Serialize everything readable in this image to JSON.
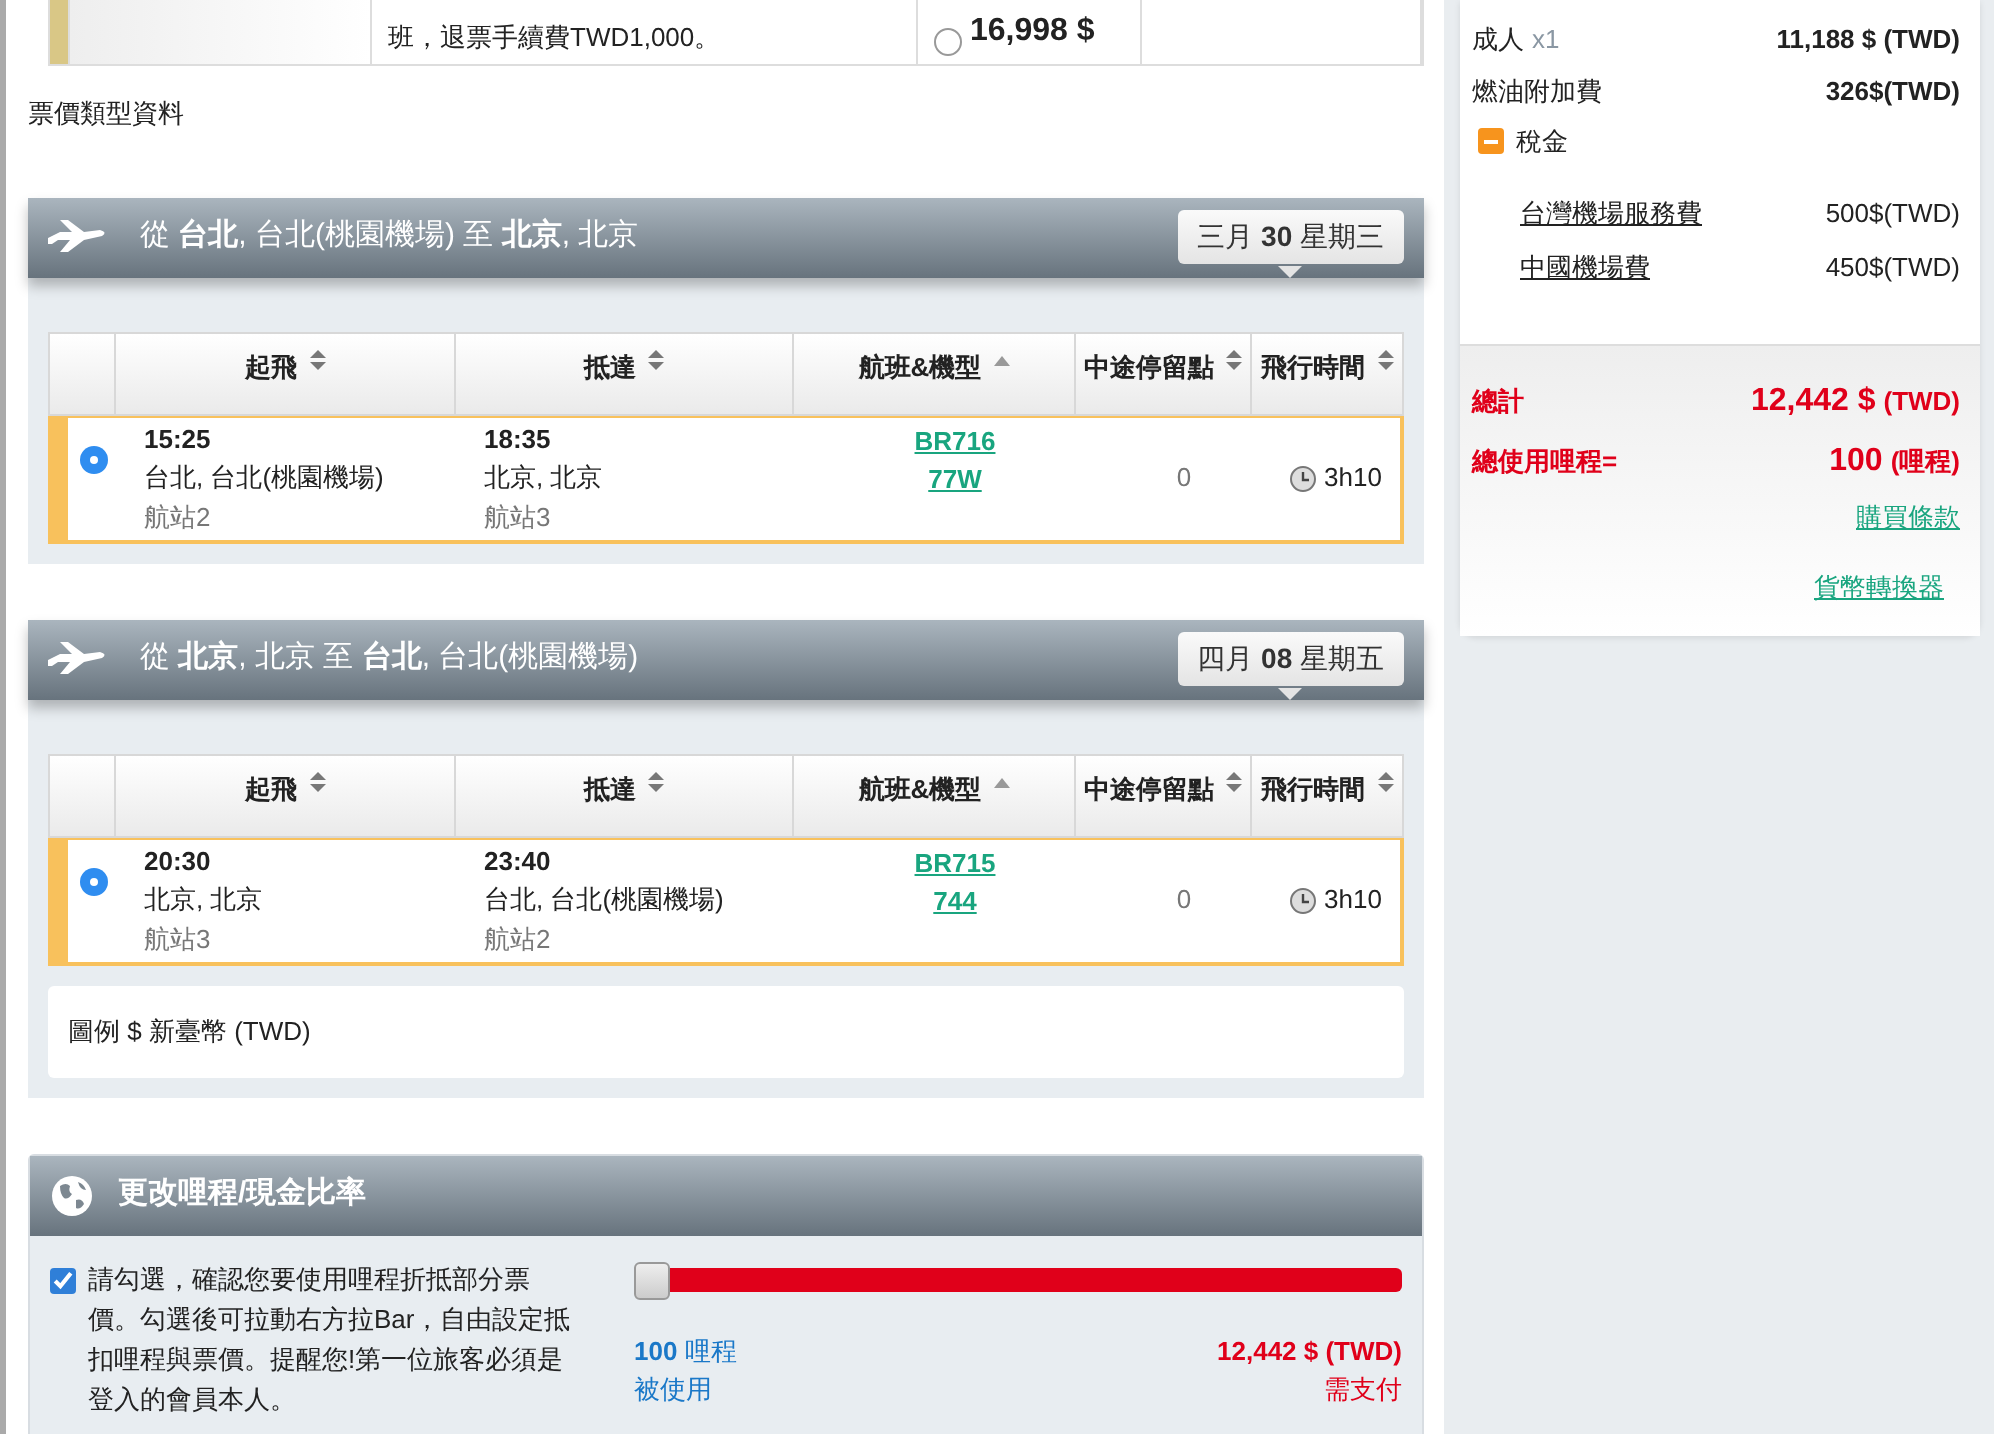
{
  "fare_row": {
    "note": "班，退票手續費TWD1,000。",
    "price": "16,998 $",
    "selected": false
  },
  "fare_type_link": "票價類型資料",
  "segments": [
    {
      "title": "從 **台北**, 台北(桃園機場) 至 **北京**, 北京",
      "date": "三月 **30** 星期三",
      "columns": [
        {
          "label": "起飛",
          "sorted": false
        },
        {
          "label": "抵達",
          "sorted": false
        },
        {
          "label": "航班&機型",
          "sorted": true
        },
        {
          "label": "中途停留點",
          "sorted": false
        },
        {
          "label": "飛行時間",
          "sorted": false
        }
      ],
      "flights": [
        {
          "selected": true,
          "depart_time": "15:25",
          "depart_city": "台北, 台北(桃園機場)",
          "depart_terminal": "航站2",
          "arrive_time": "18:35",
          "arrive_city": "北京, 北京",
          "arrive_terminal": "航站3",
          "flight_no": "BR716",
          "aircraft": "77W",
          "stops": "0",
          "duration": "3h10"
        }
      ]
    },
    {
      "title": "從 **北京**, 北京 至 **台北**, 台北(桃園機場)",
      "date": "四月 **08** 星期五",
      "columns": [
        {
          "label": "起飛",
          "sorted": false
        },
        {
          "label": "抵達",
          "sorted": false
        },
        {
          "label": "航班&機型",
          "sorted": true
        },
        {
          "label": "中途停留點",
          "sorted": false
        },
        {
          "label": "飛行時間",
          "sorted": false
        }
      ],
      "flights": [
        {
          "selected": true,
          "depart_time": "20:30",
          "depart_city": "北京, 北京",
          "depart_terminal": "航站3",
          "arrive_time": "23:40",
          "arrive_city": "台北, 台北(桃園機場)",
          "arrive_terminal": "航站2",
          "flight_no": "BR715",
          "aircraft": "744",
          "stops": "0",
          "duration": "3h10"
        }
      ]
    }
  ],
  "legend": "圖例 $ 新臺幣 (TWD)",
  "miles_panel": {
    "title": "更改哩程/現金比率",
    "checked": true,
    "note": "請勾選，確認您要使用哩程折抵部分票價。勾選後可拉動右方拉Bar，自由設定抵扣哩程與票價。提醒您!第一位旅客必須是登入的會員本人。",
    "level": 0,
    "miles": "**100** 哩程",
    "miles_label": "被使用",
    "cash": "12,442 $ (TWD)",
    "cash_label": "需支付"
  },
  "price_summary": {
    "rows": [
      {
        "label": "成人",
        "qty": "x1",
        "amount": "11,188 $ (TWD)"
      },
      {
        "label": "燃油附加費",
        "amount": "326$(TWD)"
      }
    ],
    "tax": {
      "label": "稅金",
      "expanded": true,
      "items": [
        {
          "label": "台灣機場服務費",
          "amount": "500$(TWD)"
        },
        {
          "label": "中國機場費",
          "amount": "450$(TWD)"
        }
      ]
    },
    "total_label": "總計",
    "total_value": "12,442 $",
    "total_unit": "(TWD)",
    "miles_label": "總使用哩程=",
    "miles_value": "100",
    "miles_unit": "(哩程)",
    "links": [
      "購買條款",
      "貨幣轉換器"
    ]
  }
}
